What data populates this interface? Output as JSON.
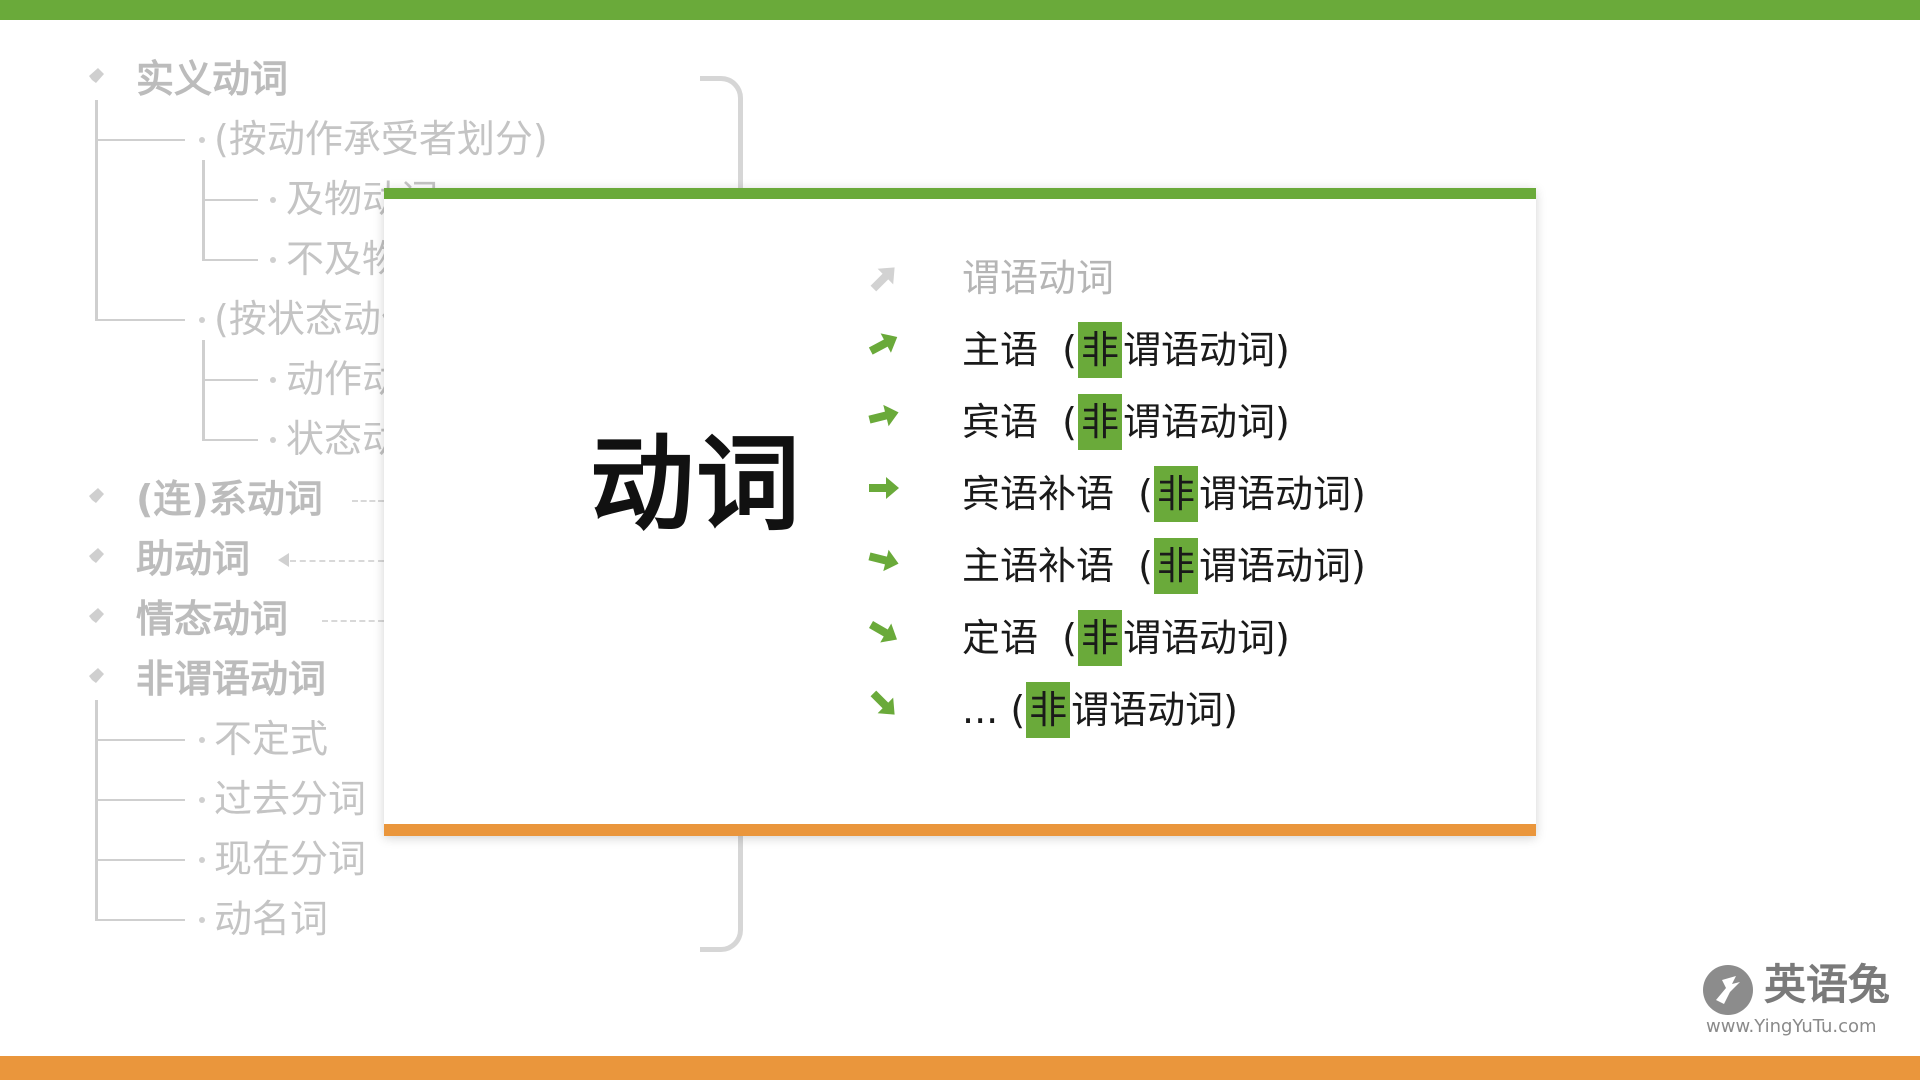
{
  "background_tree": {
    "root_items": [
      {
        "label": "实义动词"
      },
      {
        "label": "(连)系动词"
      },
      {
        "label": "助动词"
      },
      {
        "label": "情态动词"
      },
      {
        "label": "非谓语动词"
      }
    ],
    "shiyi_children": [
      {
        "label": "(按动作承受者划分)"
      },
      {
        "label": "及物动词"
      },
      {
        "label": "不及物动词"
      },
      {
        "label": "(按状态动作划分)"
      },
      {
        "label": "动作动词"
      },
      {
        "label": "状态动词"
      }
    ],
    "feiweiyu_children": [
      {
        "label": "不定式"
      },
      {
        "label": "过去分词"
      },
      {
        "label": "现在分词"
      },
      {
        "label": "动名词"
      }
    ]
  },
  "card": {
    "title": "动词",
    "items": [
      {
        "prefix": "谓语动词",
        "highlight": "",
        "suffix": "",
        "muted": true
      },
      {
        "prefix": "主语  (",
        "highlight": "非",
        "suffix": "谓语动词)",
        "muted": false
      },
      {
        "prefix": "宾语  (",
        "highlight": "非",
        "suffix": "谓语动词)",
        "muted": false
      },
      {
        "prefix": "宾语补语  (",
        "highlight": "非",
        "suffix": "谓语动词)",
        "muted": false
      },
      {
        "prefix": "主语补语  (",
        "highlight": "非",
        "suffix": "谓语动词)",
        "muted": false
      },
      {
        "prefix": "定语  (",
        "highlight": "非",
        "suffix": "谓语动词)",
        "muted": false
      },
      {
        "prefix": "... (",
        "highlight": "非",
        "suffix": "谓语动词)",
        "muted": false
      }
    ]
  },
  "logo": {
    "name": "英语兔",
    "url": "www.YingYuTu.com"
  },
  "colors": {
    "green": "#6aaa3a",
    "orange": "#ea963c",
    "faded": "#c4c4c4"
  }
}
